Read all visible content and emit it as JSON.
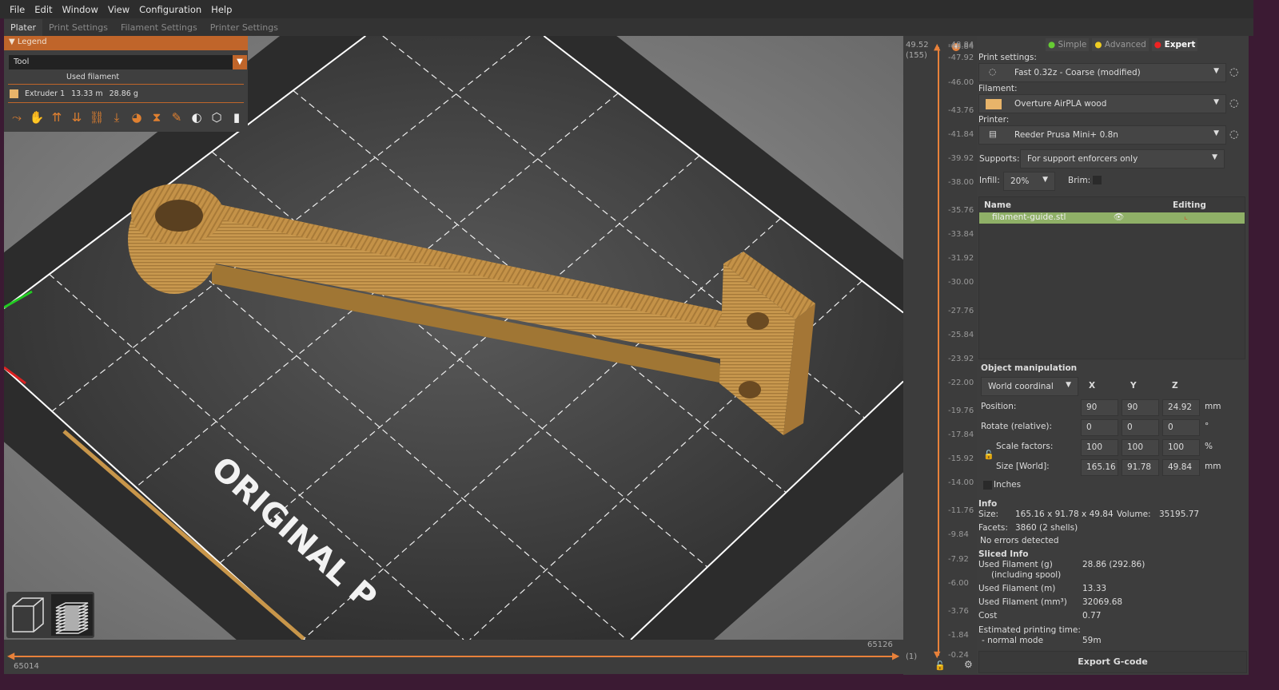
{
  "menu": [
    "File",
    "Edit",
    "Window",
    "View",
    "Configuration",
    "Help"
  ],
  "tabs": [
    "Plater",
    "Print Settings",
    "Filament Settings",
    "Printer Settings"
  ],
  "legend": {
    "title": "Legend",
    "view_type": "Tool",
    "used_filament_label": "Used filament",
    "extruder": "Extruder 1",
    "length": "13.33 m",
    "weight": "28.86 g",
    "extruder_color": "#e8b46a",
    "tool_icons": [
      "travel-icon",
      "wipe-icon",
      "retractions-icon",
      "deretractions-icon",
      "seams-icon",
      "tool-changes-icon",
      "color-changes-icon",
      "pause-icon",
      "custom-gcode-icon",
      "center-of-gravity-icon",
      "shells-icon",
      "tool-marker-icon"
    ]
  },
  "bed_text": "ORIGINAL P",
  "hslider": {
    "left_value": "65014",
    "right_value": "65126"
  },
  "vslider": {
    "top_value": "49.52",
    "top_layer": "(155)",
    "top_right": "48.84",
    "bottom_layer": "(1)",
    "ticks": [
      "48.84",
      "47.92",
      "46.00",
      "43.76",
      "41.84",
      "39.92",
      "38.00",
      "35.76",
      "33.84",
      "31.92",
      "30.00",
      "27.76",
      "25.84",
      "23.92",
      "22.00",
      "19.76",
      "17.84",
      "15.92",
      "14.00",
      "11.76",
      "9.84",
      "7.92",
      "6.00",
      "3.76",
      "1.84",
      "0.24"
    ]
  },
  "modes": {
    "simple": "Simple",
    "advanced": "Advanced",
    "expert": "Expert"
  },
  "print_settings": {
    "label": "Print settings:",
    "value": "Fast 0.32z - Coarse (modified)"
  },
  "filament": {
    "label": "Filament:",
    "value": "Overture AirPLA wood",
    "color": "#e8b46a"
  },
  "printer": {
    "label": "Printer:",
    "value": "Reeder Prusa Mini+ 0.8n"
  },
  "supports": {
    "label": "Supports:",
    "value": "For support enforcers only"
  },
  "infill": {
    "label": "Infill:",
    "value": "20%"
  },
  "brim": {
    "label": "Brim:",
    "checked": false
  },
  "objects": {
    "col_name": "Name",
    "col_editing": "Editing",
    "items": [
      {
        "name": "filament-guide.stl"
      }
    ]
  },
  "manip": {
    "title": "Object manipulation",
    "coord": "World coordinal",
    "x": "X",
    "y": "Y",
    "z": "Z",
    "position": {
      "label": "Position:",
      "x": "90",
      "y": "90",
      "z": "24.92",
      "unit": "mm"
    },
    "rotate": {
      "label": "Rotate (relative):",
      "x": "0",
      "y": "0",
      "z": "0",
      "unit": "°"
    },
    "scale": {
      "label": "Scale factors:",
      "x": "100",
      "y": "100",
      "z": "100",
      "unit": "%"
    },
    "size": {
      "label": "Size [World]:",
      "x": "165.16",
      "y": "91.78",
      "z": "49.84",
      "unit": "mm"
    },
    "inches": "Inches"
  },
  "info": {
    "title": "Info",
    "size_label": "Size:",
    "size": "165.16 x 91.78 x 49.84",
    "volume_label": "Volume:",
    "volume": "35195.77",
    "facets_label": "Facets:",
    "facets": "3860 (2 shells)",
    "errors": "No errors detected"
  },
  "sliced": {
    "title": "Sliced Info",
    "rows": [
      {
        "label": "Used Filament (g)",
        "sub": "(including spool)",
        "value": "28.86 (292.86)"
      },
      {
        "label": "Used Filament (m)",
        "value": "13.33"
      },
      {
        "label": "Used Filament (mm³)",
        "value": "32069.68"
      },
      {
        "label": "Cost",
        "value": "0.77"
      },
      {
        "label": "Estimated printing time:",
        "sub": "- normal mode",
        "value": "59m"
      }
    ]
  },
  "export_label": "Export G-code",
  "accent": "#e8813a"
}
